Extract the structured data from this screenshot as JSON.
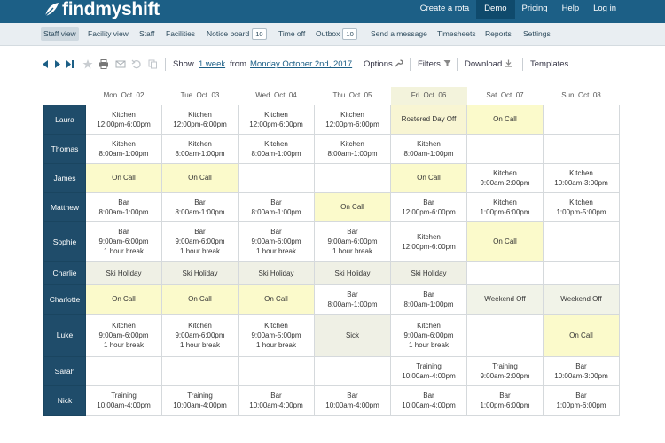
{
  "app": {
    "logo_text": "findmyshift"
  },
  "topnav": {
    "items": [
      {
        "label": "Create a rota"
      },
      {
        "label": "Demo"
      },
      {
        "label": "Pricing"
      },
      {
        "label": "Help"
      },
      {
        "label": "Log in"
      }
    ]
  },
  "subnav": {
    "items": [
      {
        "label": "Staff view"
      },
      {
        "label": "Facility view"
      },
      {
        "label": "Staff"
      },
      {
        "label": "Facilities"
      },
      {
        "label": "Notice board",
        "badge": "10"
      },
      {
        "label": "Time off"
      },
      {
        "label": "Outbox",
        "badge": "10"
      },
      {
        "label": "Send a message"
      },
      {
        "label": "Timesheets"
      },
      {
        "label": "Reports"
      },
      {
        "label": "Settings"
      }
    ]
  },
  "toolbar": {
    "show_label": "Show",
    "period": "1 week",
    "from_label": "from",
    "date": "Monday October 2nd, 2017",
    "options": "Options",
    "filters": "Filters",
    "download": "Download",
    "templates": "Templates"
  },
  "schedule": {
    "days": [
      "Mon. Oct. 02",
      "Tue. Oct. 03",
      "Wed. Oct. 04",
      "Thu. Oct. 05",
      "Fri. Oct. 06",
      "Sat. Oct. 07",
      "Sun. Oct. 08"
    ],
    "rows": [
      {
        "name": "Laura",
        "cells": [
          {
            "lines": [
              "Kitchen",
              "12:00pm-6:00pm"
            ],
            "type": "shift"
          },
          {
            "lines": [
              "Kitchen",
              "12:00pm-6:00pm"
            ],
            "type": "shift"
          },
          {
            "lines": [
              "Kitchen",
              "12:00pm-6:00pm"
            ],
            "type": "shift"
          },
          {
            "lines": [
              "Kitchen",
              "12:00pm-6:00pm"
            ],
            "type": "shift"
          },
          {
            "lines": [
              "Rostered Day Off"
            ],
            "type": "rostered"
          },
          {
            "lines": [
              "On Call"
            ],
            "type": "oncall"
          },
          {
            "lines": [],
            "type": "empty"
          }
        ]
      },
      {
        "name": "Thomas",
        "cells": [
          {
            "lines": [
              "Kitchen",
              "8:00am-1:00pm"
            ],
            "type": "shift"
          },
          {
            "lines": [
              "Kitchen",
              "8:00am-1:00pm"
            ],
            "type": "shift"
          },
          {
            "lines": [
              "Kitchen",
              "8:00am-1:00pm"
            ],
            "type": "shift"
          },
          {
            "lines": [
              "Kitchen",
              "8:00am-1:00pm"
            ],
            "type": "shift"
          },
          {
            "lines": [
              "Kitchen",
              "8:00am-1:00pm"
            ],
            "type": "shift"
          },
          {
            "lines": [],
            "type": "empty"
          },
          {
            "lines": [],
            "type": "empty"
          }
        ]
      },
      {
        "name": "James",
        "cells": [
          {
            "lines": [
              "On Call"
            ],
            "type": "oncall"
          },
          {
            "lines": [
              "On Call"
            ],
            "type": "oncall"
          },
          {
            "lines": [],
            "type": "empty"
          },
          {
            "lines": [],
            "type": "empty"
          },
          {
            "lines": [
              "On Call"
            ],
            "type": "oncall"
          },
          {
            "lines": [
              "Kitchen",
              "9:00am-2:00pm"
            ],
            "type": "shift"
          },
          {
            "lines": [
              "Kitchen",
              "10:00am-3:00pm"
            ],
            "type": "shift"
          }
        ]
      },
      {
        "name": "Matthew",
        "cells": [
          {
            "lines": [
              "Bar",
              "8:00am-1:00pm"
            ],
            "type": "shift"
          },
          {
            "lines": [
              "Bar",
              "8:00am-1:00pm"
            ],
            "type": "shift"
          },
          {
            "lines": [
              "Bar",
              "8:00am-1:00pm"
            ],
            "type": "shift"
          },
          {
            "lines": [
              "On Call"
            ],
            "type": "oncall"
          },
          {
            "lines": [
              "Bar",
              "12:00pm-6:00pm"
            ],
            "type": "shift"
          },
          {
            "lines": [
              "Kitchen",
              "1:00pm-6:00pm"
            ],
            "type": "shift"
          },
          {
            "lines": [
              "Kitchen",
              "1:00pm-5:00pm"
            ],
            "type": "shift"
          }
        ]
      },
      {
        "name": "Sophie",
        "cells": [
          {
            "lines": [
              "Bar",
              "9:00am-6:00pm",
              "1 hour break"
            ],
            "type": "shift"
          },
          {
            "lines": [
              "Bar",
              "9:00am-6:00pm",
              "1 hour break"
            ],
            "type": "shift"
          },
          {
            "lines": [
              "Bar",
              "9:00am-6:00pm",
              "1 hour break"
            ],
            "type": "shift"
          },
          {
            "lines": [
              "Bar",
              "9:00am-6:00pm",
              "1 hour break"
            ],
            "type": "shift"
          },
          {
            "lines": [
              "Kitchen",
              "12:00pm-6:00pm"
            ],
            "type": "shift"
          },
          {
            "lines": [
              "On Call"
            ],
            "type": "oncall"
          },
          {
            "lines": [],
            "type": "empty"
          }
        ]
      },
      {
        "name": "Charlie",
        "cells": [
          {
            "lines": [
              "Ski Holiday"
            ],
            "type": "holiday"
          },
          {
            "lines": [
              "Ski Holiday"
            ],
            "type": "holiday"
          },
          {
            "lines": [
              "Ski Holiday"
            ],
            "type": "holiday"
          },
          {
            "lines": [
              "Ski Holiday"
            ],
            "type": "holiday"
          },
          {
            "lines": [
              "Ski Holiday"
            ],
            "type": "holiday"
          },
          {
            "lines": [],
            "type": "empty"
          },
          {
            "lines": [],
            "type": "empty"
          }
        ]
      },
      {
        "name": "Charlotte",
        "cells": [
          {
            "lines": [
              "On Call"
            ],
            "type": "oncall"
          },
          {
            "lines": [
              "On Call"
            ],
            "type": "oncall"
          },
          {
            "lines": [
              "On Call"
            ],
            "type": "oncall"
          },
          {
            "lines": [
              "Bar",
              "8:00am-1:00pm"
            ],
            "type": "shift"
          },
          {
            "lines": [
              "Bar",
              "8:00am-1:00pm"
            ],
            "type": "shift"
          },
          {
            "lines": [
              "Weekend Off"
            ],
            "type": "weekend"
          },
          {
            "lines": [
              "Weekend Off"
            ],
            "type": "weekend"
          }
        ]
      },
      {
        "name": "Luke",
        "cells": [
          {
            "lines": [
              "Kitchen",
              "9:00am-6:00pm",
              "1 hour break"
            ],
            "type": "shift"
          },
          {
            "lines": [
              "Kitchen",
              "9:00am-6:00pm",
              "1 hour break"
            ],
            "type": "shift"
          },
          {
            "lines": [
              "Kitchen",
              "9:00am-5:00pm",
              "1 hour break"
            ],
            "type": "shift"
          },
          {
            "lines": [
              "Sick"
            ],
            "type": "holiday"
          },
          {
            "lines": [
              "Kitchen",
              "9:00am-6:00pm",
              "1 hour break"
            ],
            "type": "shift"
          },
          {
            "lines": [],
            "type": "empty"
          },
          {
            "lines": [
              "On Call"
            ],
            "type": "oncall"
          }
        ]
      },
      {
        "name": "Sarah",
        "cells": [
          {
            "lines": [],
            "type": "empty"
          },
          {
            "lines": [],
            "type": "empty"
          },
          {
            "lines": [],
            "type": "empty"
          },
          {
            "lines": [],
            "type": "empty"
          },
          {
            "lines": [
              "Training",
              "10:00am-4:00pm"
            ],
            "type": "shift"
          },
          {
            "lines": [
              "Training",
              "9:00am-2:00pm"
            ],
            "type": "shift"
          },
          {
            "lines": [
              "Bar",
              "10:00am-3:00pm"
            ],
            "type": "shift"
          }
        ]
      },
      {
        "name": "Nick",
        "cells": [
          {
            "lines": [
              "Training",
              "10:00am-4:00pm"
            ],
            "type": "shift"
          },
          {
            "lines": [
              "Training",
              "10:00am-4:00pm"
            ],
            "type": "shift"
          },
          {
            "lines": [
              "Bar",
              "10:00am-4:00pm"
            ],
            "type": "shift"
          },
          {
            "lines": [
              "Bar",
              "10:00am-4:00pm"
            ],
            "type": "shift"
          },
          {
            "lines": [
              "Bar",
              "10:00am-4:00pm"
            ],
            "type": "shift"
          },
          {
            "lines": [
              "Bar",
              "1:00pm-6:00pm"
            ],
            "type": "shift"
          },
          {
            "lines": [
              "Bar",
              "1:00pm-6:00pm"
            ],
            "type": "shift"
          }
        ]
      }
    ]
  },
  "colors": {
    "brand": "#1c5f86",
    "employee_cell": "#1f4c6a",
    "on_call": "#fbfacb",
    "today_header": "#f3f3dc"
  }
}
